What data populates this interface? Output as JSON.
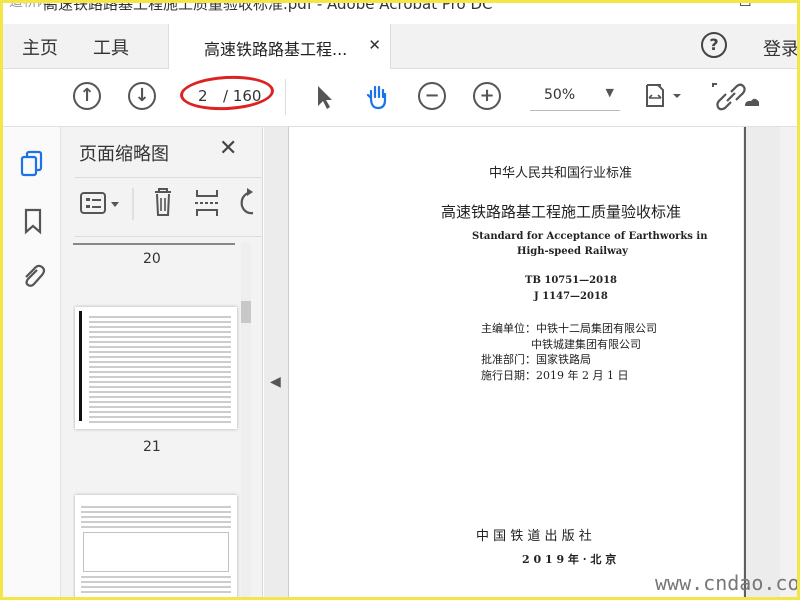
{
  "window": {
    "logo_text": "道桥网",
    "title": "高速铁路路基工程施工质量验收标准.pdf - Adobe Acrobat Pro DC"
  },
  "tabs": {
    "home": "主页",
    "tools": "工具",
    "doc": "高速铁路路基工程...",
    "help": "?",
    "login": "登录"
  },
  "toolbar": {
    "page_current": "2",
    "page_total": "/ 160",
    "zoom": "50%"
  },
  "panel": {
    "title": "页面缩略图",
    "pages": [
      "20",
      "21"
    ]
  },
  "document": {
    "line1": "中华人民共和国行业标准",
    "line2": "高速铁路路基工程施工质量验收标准",
    "line3": "Standard for Acceptance of Earthworks in",
    "line4": "High-speed Railway",
    "line5": "TB 10751—2018",
    "line6": "J 1147—2018",
    "line7": "主编单位：中铁十二局集团有限公司",
    "line8": "中铁城建集团有限公司",
    "line9": "批准部门：国家铁路局",
    "line10": "施行日期：2019 年 2 月 1 日",
    "publisher": "中 国 铁 道 出 版 社",
    "year_place": "2 0 1 9 年 · 北 京"
  },
  "watermark": "www.cndao.com",
  "colors": {
    "accent": "#1a73e8",
    "annotation": "#dd2222",
    "frame": "#f2e64a"
  }
}
